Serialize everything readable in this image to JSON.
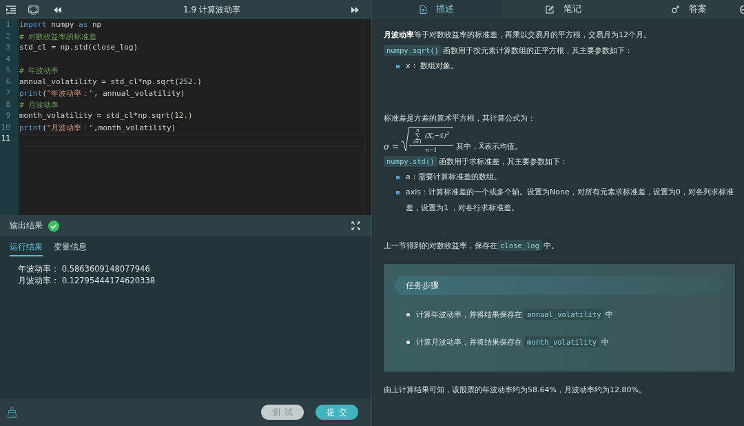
{
  "editor": {
    "title": "1.9 计算波动率",
    "lines": [
      {
        "number": "1",
        "current": false,
        "tokens": [
          {
            "kind": "keyword",
            "text": "import"
          },
          {
            "kind": "plain",
            "text": " numpy "
          },
          {
            "kind": "keyword",
            "text": "as"
          },
          {
            "kind": "plain",
            "text": " np"
          }
        ]
      },
      {
        "number": "2",
        "current": false,
        "tokens": [
          {
            "kind": "comment",
            "text": "# 对数收益率的标准差"
          }
        ]
      },
      {
        "number": "3",
        "current": false,
        "tokens": [
          {
            "kind": "plain",
            "text": "std_cl = np.std(close_log)"
          }
        ]
      },
      {
        "number": "4",
        "current": false
      },
      {
        "number": "5",
        "current": false,
        "tokens": [
          {
            "kind": "comment",
            "text": "# 年波动率"
          }
        ]
      },
      {
        "number": "6",
        "current": false,
        "tokens": [
          {
            "kind": "plain",
            "text": "annual_volatility = std_cl*np.sqrt("
          },
          {
            "kind": "number",
            "text": "252."
          },
          {
            "kind": "plain",
            "text": ")"
          }
        ]
      },
      {
        "number": "7",
        "current": false,
        "tokens": [
          {
            "kind": "keyword",
            "text": "print"
          },
          {
            "kind": "plain",
            "text": "("
          },
          {
            "kind": "string",
            "text": "\"年波动率：\""
          },
          {
            "kind": "plain",
            "text": ", annual_volatility)"
          }
        ]
      },
      {
        "number": "8",
        "current": false,
        "tokens": [
          {
            "kind": "comment",
            "text": "# 月波动率"
          }
        ]
      },
      {
        "number": "9",
        "current": false,
        "tokens": [
          {
            "kind": "plain",
            "text": "month_volatility = std_cl*np.sqrt("
          },
          {
            "kind": "number",
            "text": "12."
          },
          {
            "kind": "plain",
            "text": ")"
          }
        ]
      },
      {
        "number": "10",
        "current": false,
        "tokens": [
          {
            "kind": "keyword",
            "text": "print"
          },
          {
            "kind": "plain",
            "text": "("
          },
          {
            "kind": "string",
            "text": "\"月波动率：\""
          },
          {
            "kind": "plain",
            "text": ",month_volatility)"
          }
        ]
      },
      {
        "number": "11",
        "current": true
      }
    ]
  },
  "output": {
    "title": "输出结果",
    "success": true,
    "tabs": [
      {
        "label": "运行结果",
        "selected": true
      },
      {
        "label": "变量信息",
        "selected": false
      }
    ],
    "lines": [
      "年波动率： 0.5863609148077946",
      "月波动率： 0.12795444174620338"
    ]
  },
  "actions": {
    "buttons": [
      {
        "label": "测试",
        "kind": "secondary"
      },
      {
        "label": "提交",
        "kind": "primary"
      }
    ]
  },
  "panel_tabs": [
    {
      "label": "描述",
      "selected": true
    },
    {
      "label": "笔记",
      "selected": false
    },
    {
      "label": "答案",
      "selected": false
    }
  ],
  "description": {
    "month_volatility": "**月波动率**等于对数收益率的标准差，再乘以交易月的平方根，交易月为12个月。",
    "sqrt_intro": [
      {
        "kind": "code",
        "text": "numpy.sqrt()"
      },
      {
        "kind": "text",
        "text": "函数用于按元素计算数组的正平方根，其主要参数如下："
      }
    ],
    "sqrt_params": [
      "x： 数组对象。"
    ],
    "std_intro": "标准差是方差的算术平方根，其计算公式为：",
    "formula": {
      "lhs": "σ =",
      "sum_upper": "n",
      "sum_symbol": "∑",
      "sum_lower": "i=1",
      "summand": "(X$_{i}$−x̄)$^{2}$",
      "denominator": "n−1",
      "note": "其中，X̄表示均值。"
    },
    "std_func": [
      {
        "kind": "code",
        "text": "numpy.std()"
      },
      {
        "kind": "text",
        "text": "函数用于求标准差，其主要参数如下："
      }
    ],
    "std_params": [
      "a：需要计算标准差的数组。",
      "axis：计算标准差的一个或多个轴。设置为None，对所有元素求标准差，设置为0，对各列求标准差，设置为1 ，对各行求标准差。"
    ],
    "close_log": [
      {
        "kind": "text",
        "text": "上一节得到的对数收益率，保存在"
      },
      {
        "kind": "code",
        "text": "close_log"
      },
      {
        "kind": "text",
        "text": "中。"
      }
    ],
    "task": {
      "title": "任务步骤",
      "steps": [
        [
          {
            "kind": "text",
            "text": "计算年波动率，并将结果保存在"
          },
          {
            "kind": "code",
            "text": "annual_volatility"
          },
          {
            "kind": "text",
            "text": "中"
          }
        ],
        [
          {
            "kind": "text",
            "text": "计算月波动率，并将结果保存在"
          },
          {
            "kind": "code",
            "text": "month_volatility"
          },
          {
            "kind": "text",
            "text": "中"
          }
        ]
      ]
    },
    "conclusion": "由上计算结果可知，该股票的年波动率约为58.64%，月波动率约为12.80%。"
  }
}
